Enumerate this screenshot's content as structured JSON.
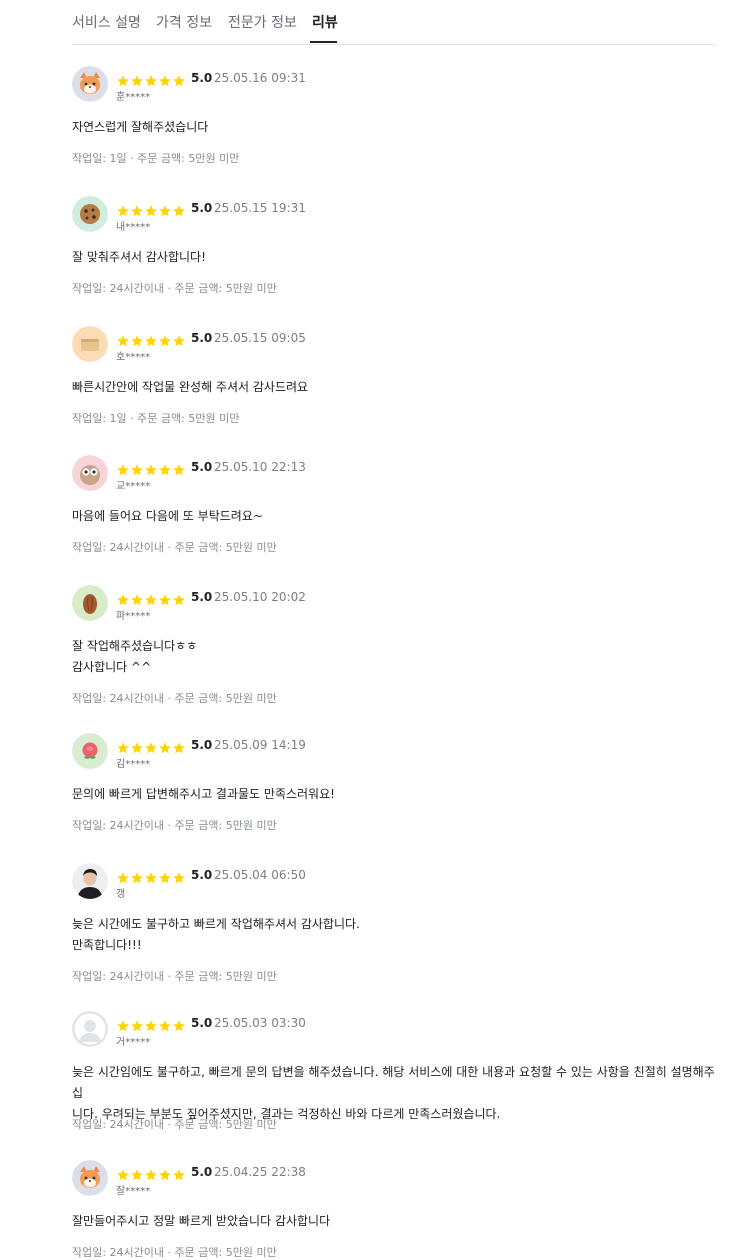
{
  "tabs": [
    {
      "label": "서비스 설명",
      "active": false
    },
    {
      "label": "가격 정보",
      "active": false
    },
    {
      "label": "전문가 정보",
      "active": false
    },
    {
      "label": "리뷰",
      "active": true
    }
  ],
  "colors": {
    "star": "#ffd400",
    "tab_active": "#222222",
    "meta": "#888d96"
  },
  "reviews": [
    {
      "avatar": "fox-avatar",
      "rating": 5,
      "score": "5.0",
      "date": "25.05.16 09:31",
      "nick": "훈*****",
      "content": [
        "자연스럽게 잘해주셨습니다"
      ],
      "meta": "작업일: 1일 · 주문 금액: 5만원 미만"
    },
    {
      "avatar": "cookie-avatar",
      "rating": 5,
      "score": "5.0",
      "date": "25.05.15 19:31",
      "nick": "내*****",
      "content": [
        "잘 맞춰주셔서 감사합니다!"
      ],
      "meta": "작업일: 24시간이내 · 주문 금액: 5만원 미만"
    },
    {
      "avatar": "bread-avatar",
      "rating": 5,
      "score": "5.0",
      "date": "25.05.15 09:05",
      "nick": "호*****",
      "content": [
        "빠른시간안에 작업물 완성해 주셔서 감사드려요"
      ],
      "meta": "작업일: 1일 · 주문 금액: 5만원 미만"
    },
    {
      "avatar": "owl-avatar",
      "rating": 5,
      "score": "5.0",
      "date": "25.05.10 22:13",
      "nick": "교*****",
      "content": [
        "마음에  들어요 다음에 또 부탁드려요~"
      ],
      "meta": "작업일: 24시간이내 · 주문 금액: 5만원 미만"
    },
    {
      "avatar": "almond-avatar",
      "rating": 5,
      "score": "5.0",
      "date": "25.05.10 20:02",
      "nick": "파*****",
      "content": [
        "잘 작업해주셨습니다ㅎㅎ",
        "감사합니다 ^^"
      ],
      "meta": "작업일: 24시간이내 · 주문 금액: 5만원 미만"
    },
    {
      "avatar": "rose-avatar",
      "rating": 5,
      "score": "5.0",
      "date": "25.05.09 14:19",
      "nick": "김*****",
      "content": [
        "문의에 빠르게 답변해주시고 결과물도 만족스러워요!"
      ],
      "meta": "작업일: 24시간이내 · 주문 금액: 5만원 미만"
    },
    {
      "avatar": "person-photo-avatar",
      "rating": 5,
      "score": "5.0",
      "date": "25.05.04 06:50",
      "nick": "갱",
      "content": [
        "늦은 시간에도 불구하고 빠르게 작업해주셔서 감사합니다.",
        "만족합니다!!!"
      ],
      "meta": "작업일: 24시간이내 · 주문 금액: 5만원 미만"
    },
    {
      "avatar": "default-avatar",
      "rating": 5,
      "score": "5.0",
      "date": "25.05.03 03:30",
      "nick": "거*****",
      "content": [
        "늦은 시간임에도 불구하고, 빠르게 문의 답변을 해주셨습니다. 해당 서비스에 대한 내용과 요청할 수 있는 사항을 친절히 설명해주십",
        "니다. 우려되는 부분도 짚어주셨지만, 결과는 걱정하신 바와 다르게 만족스러웠습니다."
      ],
      "meta": "작업일: 24시간이내 · 주문 금액: 5만원 미만"
    },
    {
      "avatar": "fox-avatar",
      "rating": 5,
      "score": "5.0",
      "date": "25.04.25 22:38",
      "nick": "잘*****",
      "content": [
        "잘만들어주시고 정말 빠르게 받았습니다 감사합니다"
      ],
      "meta": "작업일: 24시간이내 · 주문 금액: 5만원 미만"
    }
  ]
}
